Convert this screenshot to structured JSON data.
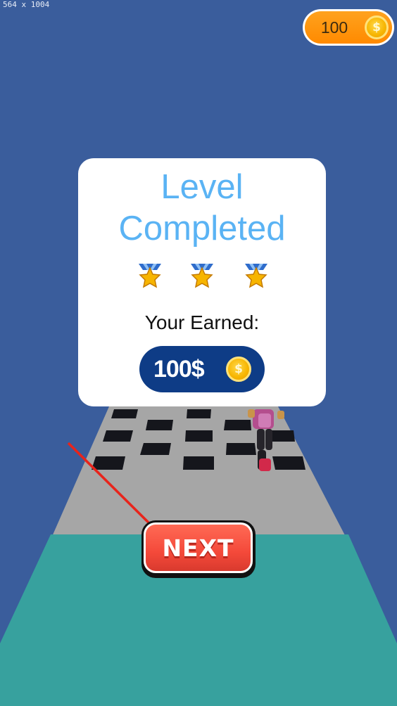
{
  "overlay": {
    "size_label": "564 x 1004"
  },
  "hud": {
    "coins": "100",
    "coin_icon": "dollar-coin-icon",
    "coin_symbol": "$"
  },
  "dialog": {
    "title_line1": "Level",
    "title_line2": "Completed",
    "stars_earned": 3,
    "stars_total": 3,
    "earned_label": "Your Earned:",
    "reward_amount": "100$",
    "reward_icon": "dollar-coin-icon"
  },
  "next_button": {
    "label": "NEXT"
  },
  "colors": {
    "sky": "#3A5D9C",
    "track": "#A6A6A6",
    "ground": "#37A19E",
    "title": "#5AB3F4",
    "reward_pill": "#0E3C86",
    "coin_counter": "#FF8A00",
    "next_button": "#F4493A"
  }
}
